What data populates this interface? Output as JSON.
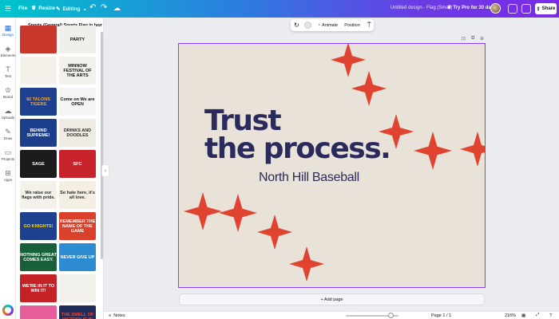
{
  "topbar": {
    "file": "File",
    "resize": "Resize",
    "editing": "Editing",
    "doc_title": "Untitled design - Flag (Small)",
    "try_pro": "Try Pro for 30 days",
    "share": "Share"
  },
  "rail": [
    {
      "label": "Design",
      "icon": "design-icon"
    },
    {
      "label": "Elements",
      "icon": "elements-icon"
    },
    {
      "label": "Text",
      "icon": "text-icon"
    },
    {
      "label": "Brand",
      "icon": "brand-icon"
    },
    {
      "label": "Uploads",
      "icon": "uploads-icon"
    },
    {
      "label": "Draw",
      "icon": "draw-icon"
    },
    {
      "label": "Projects",
      "icon": "projects-icon"
    },
    {
      "label": "Apps",
      "icon": "apps-icon"
    }
  ],
  "panel": {
    "title": "Sports (General) Sports Flag in Ivory Bri...",
    "templates": [
      {
        "text": "",
        "bg": "#c9372c",
        "fg": "#fff"
      },
      {
        "text": "PARTY",
        "bg": "#f1efe9",
        "fg": "#111"
      },
      {
        "text": "",
        "bg": "#f4f1ea",
        "fg": "#111"
      },
      {
        "text": "MINNOW FESTIVAL OF THE ARTS",
        "bg": "#f3f1ec",
        "fg": "#111"
      },
      {
        "text": "82 TALONS TIGERS",
        "bg": "#1f3f8f",
        "fg": "#f5a623"
      },
      {
        "text": "Come on We are OPEN",
        "bg": "#f4f4f4",
        "fg": "#111"
      },
      {
        "text": "BEHIND SUPREME!",
        "bg": "#1d3f8b",
        "fg": "#fff"
      },
      {
        "text": "DRINKS AND DOODLES",
        "bg": "#efece4",
        "fg": "#2b2b2b"
      },
      {
        "text": "SAGE",
        "bg": "#1b1b1b",
        "fg": "#fff"
      },
      {
        "text": "SFC",
        "bg": "#c8232c",
        "fg": "#fff"
      },
      {
        "text": "We raise our flags with pride.",
        "bg": "#f4f1ea",
        "fg": "#2b2b2b"
      },
      {
        "text": "So hate here, it's all love.",
        "bg": "#f5efe3",
        "fg": "#2b2b2b"
      },
      {
        "text": "GO KNIGHTS!",
        "bg": "#1f3f8f",
        "fg": "#f8d81c"
      },
      {
        "text": "REMEMBER THE NAME OF THE GAME",
        "bg": "#d9412c",
        "fg": "#fff"
      },
      {
        "text": "NOTHING GREAT COMES EASY.",
        "bg": "#17603a",
        "fg": "#fff"
      },
      {
        "text": "NEVER GIVE UP",
        "bg": "#2c8bd1",
        "fg": "#fff"
      },
      {
        "text": "WE'RE IN IT TO WIN IT!",
        "bg": "#c42227",
        "fg": "#fff"
      },
      {
        "text": "",
        "bg": "#f2f0ea",
        "fg": "#2b2b2b"
      },
      {
        "text": "",
        "bg": "#e85d9b",
        "fg": "#fff"
      },
      {
        "text": "THE SMELL OF VICTORY IS IN THE AIR",
        "bg": "#1e2c5a",
        "fg": "#e94b3c"
      }
    ]
  },
  "context_toolbar": {
    "animate": "Animate",
    "position": "Position"
  },
  "canvas": {
    "headline_line1": "Trust",
    "headline_line2": "the process.",
    "subtitle": "North Hill Baseball",
    "bg_color": "#e9e2d8",
    "text_color": "#2a2b5c",
    "star_color": "#e0432f"
  },
  "add_page": "+ Add page",
  "status": {
    "notes": "Notes",
    "page": "Page 1 / 1",
    "zoom": "216%"
  }
}
